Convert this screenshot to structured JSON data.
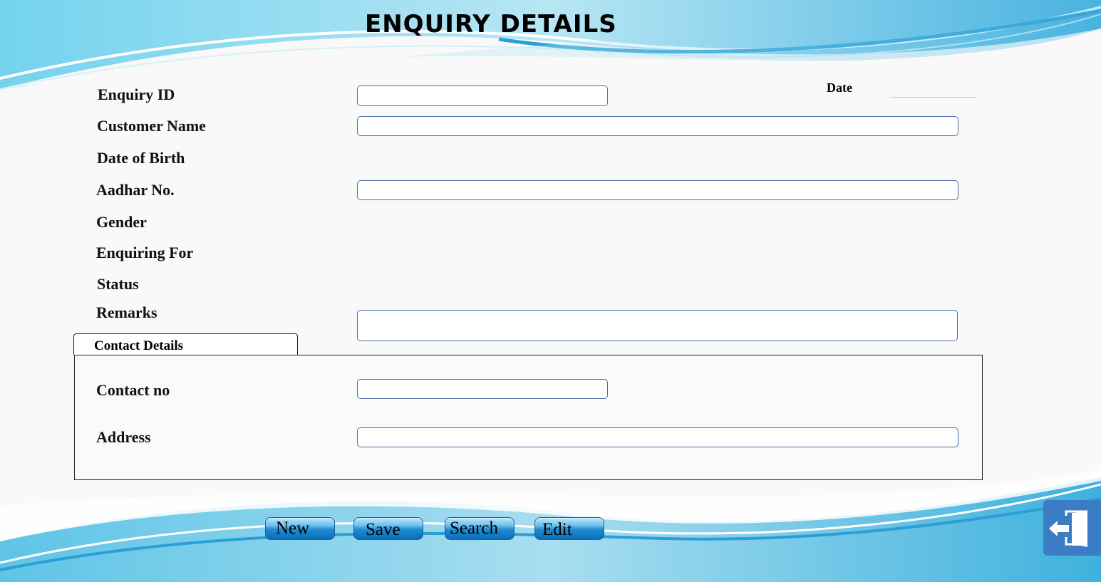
{
  "title": "ENQUIRY DETAILS",
  "date_label": "Date",
  "form": {
    "enquiry_id": "Enquiry ID",
    "customer_name": "Customer Name",
    "date_of_birth": "Date of Birth",
    "aadhar_no": "Aadhar No.",
    "gender": "Gender",
    "enquiring_for": "Enquiring For",
    "status": "Status",
    "remarks": "Remarks"
  },
  "contact": {
    "tab_label": "Contact Details",
    "contact_no": "Contact no",
    "address": "Address"
  },
  "buttons": {
    "new": "New",
    "save": "Save",
    "search": "Search",
    "edit": "Edit"
  },
  "exit_icon": "exit-door-icon",
  "colors": {
    "button": "#1f8ad0",
    "accent": "#3b7cc4",
    "wave": "#4cc3e8"
  }
}
